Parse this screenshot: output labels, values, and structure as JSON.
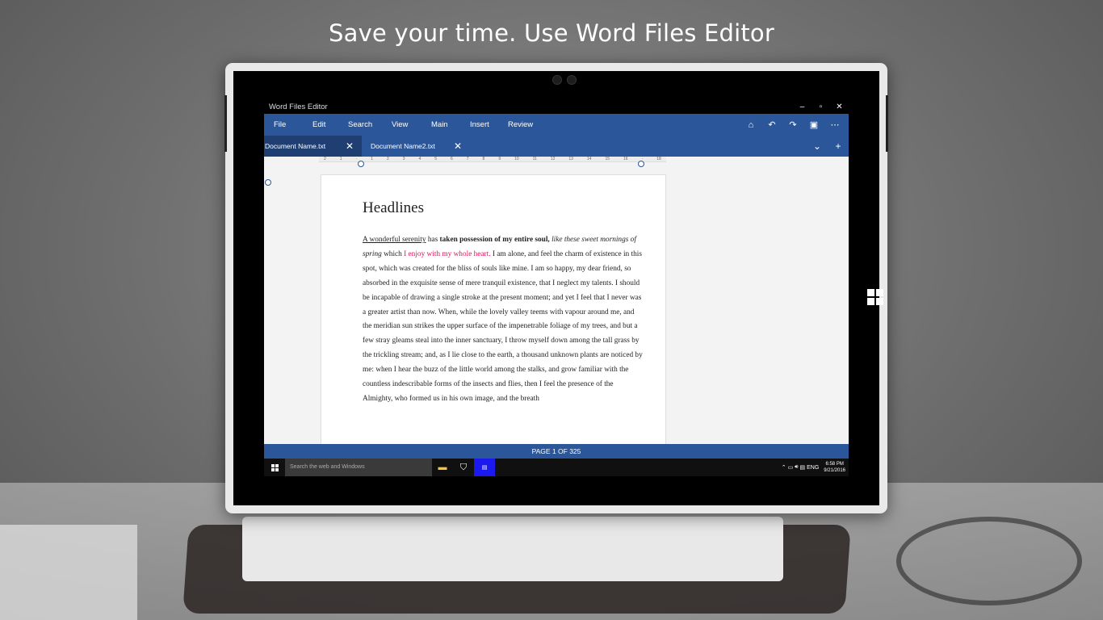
{
  "headline": "Save your time. Use Word Files Editor",
  "app": {
    "title": "Word Files Editor",
    "window_controls": {
      "minimize": "–",
      "restore": "▫",
      "close": "✕"
    },
    "menu": [
      "File",
      "Edit",
      "Search",
      "View",
      "Main",
      "Insert",
      "Review"
    ],
    "menu_icons": [
      "home-icon",
      "undo-icon",
      "redo-icon",
      "save-icon",
      "more-icon"
    ],
    "tabs": [
      {
        "label": "Document Name.txt",
        "active": true
      },
      {
        "label": "Document Name2.txt",
        "active": false
      }
    ],
    "ruler_numbers": [
      "2",
      "1",
      "",
      "1",
      "2",
      "3",
      "4",
      "5",
      "6",
      "7",
      "8",
      "9",
      "10",
      "11",
      "12",
      "13",
      "14",
      "15",
      "16",
      "",
      "18"
    ],
    "document": {
      "heading": "Headlines",
      "p1_underlined": "A wonderful serenity",
      "p1_has": " has ",
      "p1_bold": "taken possession of my entire soul,",
      "p1_italic": " like these sweet mornings of spring",
      "p1_which": " which ",
      "p1_pink": "I enjoy with my whole heart.",
      "p1_rest": " I am alone, and feel the charm of existence in this spot, which was created for the bliss of souls like mine. I am so happy, my dear friend, so absorbed in the exquisite sense of mere tranquil existence, that I neglect my talents. I should be incapable of drawing a single stroke at the present moment; and yet I feel that I never was a greater artist than now. When, while the lovely valley teems with vapour around me, and the meridian sun strikes the upper surface of the impenetrable foliage of my trees, and but a few stray gleams steal into the inner sanctuary, I throw myself down among the tall grass by the trickling stream; and, as I lie close to the earth, a thousand unknown plants are noticed by me: when I hear the buzz of the little world among the stalks, and grow familiar with the countless indescribable forms of the insects and flies, then I feel the presence of the Almighty, who formed us in his own image, and the breath"
    },
    "status": "PAGE 1 OF 325"
  },
  "taskbar": {
    "search_placeholder": "Search the web and Windows",
    "tray_lang": "ENG",
    "time": "6:58 PM",
    "date": "9/21/2016"
  },
  "colors": {
    "accent": "#2b579a",
    "pink_text": "#d6195a"
  }
}
